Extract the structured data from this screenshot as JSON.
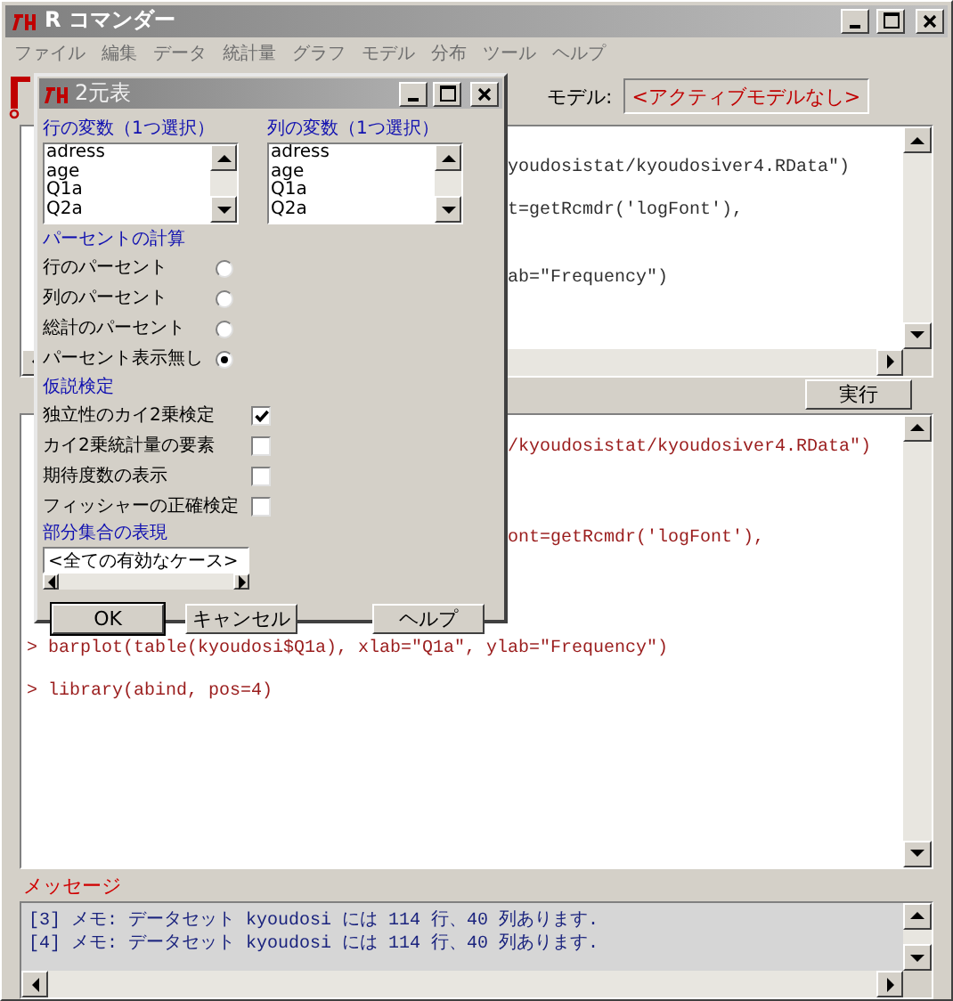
{
  "main_window": {
    "title": "R コマンダー",
    "menu": [
      "ファイル",
      "編集",
      "データ",
      "統計量",
      "グラフ",
      "モデル",
      "分布",
      "ツール",
      "ヘルプ"
    ],
    "toolbar": {
      "model_label": "モデル:",
      "model_button": "<アクティブモデルなし>"
    },
    "script_lines": [
      {
        "text": "youdosistat/kyoudosiver4.RData\")",
        "kind": "clipped"
      },
      {
        "text": "t=getRcmdr('logFont'),",
        "kind": "clipped"
      },
      {
        "text": "ab=\"Frequency\")",
        "kind": "clipped"
      }
    ],
    "run_button": "実行",
    "output_lines": [
      {
        "text": "/kyoudosistat/kyoudosiver4.RData\")",
        "kind": "clipped"
      },
      {
        "text": "ont=getRcmdr('logFont'),",
        "kind": "clipped"
      },
      {
        "text": "> barplot(table(kyoudosi$Q1a), xlab=\"Q1a\", ylab=\"Frequency\")",
        "kind": "full"
      },
      {
        "text": "> library(abind, pos=4)",
        "kind": "full"
      }
    ],
    "messages": {
      "label": "メッセージ",
      "lines": [
        "[3] メモ: データセット kyoudosi には 114 行、40 列あります.",
        "[4] メモ: データセット kyoudosi には 114 行、40 列あります."
      ]
    }
  },
  "dialog": {
    "title": "2元表",
    "row_variable": {
      "label": "行の変数（1つ選択）",
      "items": [
        "adress",
        "age",
        "Q1a",
        "Q2a"
      ]
    },
    "column_variable": {
      "label": "列の変数（1つ選択）",
      "items": [
        "adress",
        "age",
        "Q1a",
        "Q2a"
      ]
    },
    "percentages": {
      "label": "パーセントの計算",
      "options": [
        {
          "label": "行のパーセント",
          "selected": false
        },
        {
          "label": "列のパーセント",
          "selected": false
        },
        {
          "label": "総計のパーセント",
          "selected": false
        },
        {
          "label": "パーセント表示無し",
          "selected": true
        }
      ]
    },
    "tests": {
      "label": "仮説検定",
      "options": [
        {
          "label": "独立性のカイ2乗検定",
          "checked": true
        },
        {
          "label": "カイ2乗統計量の要素",
          "checked": false
        },
        {
          "label": "期待度数の表示",
          "checked": false
        },
        {
          "label": "フィッシャーの正確検定",
          "checked": false
        }
      ]
    },
    "subset": {
      "label": "部分集合の表現",
      "value": "<全ての有効なケース>"
    },
    "buttons": [
      "OK",
      "キャンセル",
      "ヘルプ"
    ]
  }
}
